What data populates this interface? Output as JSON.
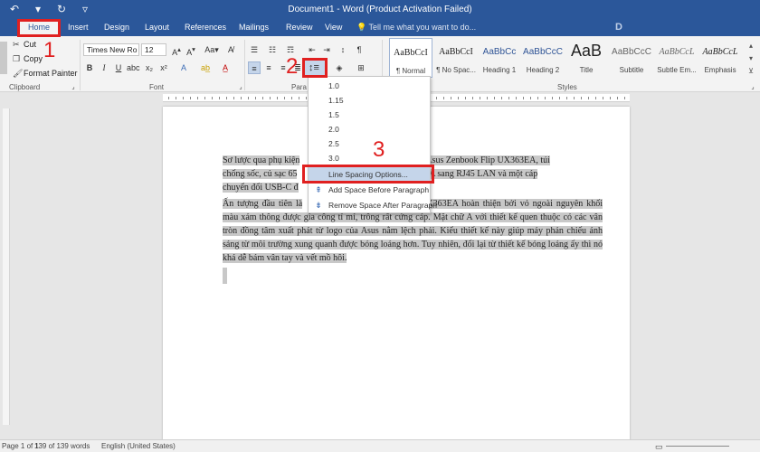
{
  "titlebar": {
    "title": "Document1 - Word (Product Activation Failed)"
  },
  "tabs": [
    {
      "label": "Home"
    },
    {
      "label": "Insert"
    },
    {
      "label": "Design"
    },
    {
      "label": "Layout"
    },
    {
      "label": "References"
    },
    {
      "label": "Mailings"
    },
    {
      "label": "Review"
    },
    {
      "label": "View"
    }
  ],
  "tell_me": "Tell me what you want to do...",
  "clipboard": {
    "cut": "Cut",
    "copy": "Copy",
    "format_painter": "Format Painter",
    "label": "Clipboard"
  },
  "font": {
    "name": "Times New Ro",
    "size": "12",
    "label": "Font"
  },
  "paragraph": {
    "label": "Para"
  },
  "styles": {
    "label": "Styles",
    "items": [
      {
        "preview": "AaBbCcI",
        "name": "¶ Normal"
      },
      {
        "preview": "AaBbCcI",
        "name": "¶ No Spac..."
      },
      {
        "preview": "AaBbCc",
        "name": "Heading 1"
      },
      {
        "preview": "AaBbCcC",
        "name": "Heading 2"
      },
      {
        "preview": "AaB",
        "name": "Title"
      },
      {
        "preview": "AaBbCcC",
        "name": "Subtitle"
      },
      {
        "preview": "AaBbCcL",
        "name": "Subtle Em..."
      },
      {
        "preview": "AaBbCcL",
        "name": "Emphasis"
      }
    ]
  },
  "line_spacing_menu": {
    "values": [
      "1.0",
      "1.15",
      "1.5",
      "2.0",
      "2.5",
      "3.0"
    ],
    "options": "Line Spacing Options...",
    "add_before": "Add Space Before Paragraph",
    "remove_after": "Remove Space After Paragraph"
  },
  "document": {
    "para1_a": "Sơ lược qua phụ kiện",
    "para1_b": "y Asus Zenbook Flip UX363EA, túi",
    "para1_c": "chống sốc, củ sạc 65",
    "para1_d": "yển USB-A sang RJ45 LAN và một cáp",
    "para1_e": "chuyển đổi USB-C đ",
    "para2_a": "Ấn tượng đầu tiên là",
    "para2_b": "UX363EA hoàn thiện bởi vỏ ngoài nguyên khối màu xám thông được gia công tỉ mỉ, trông rất cứng cáp. Mặt chữ A với thiết kế quen thuộc có các vân tròn đồng tâm xuất phát từ logo của Asus nằm lệch phải. Kiểu thiết kế này giúp máy phản chiếu ánh sáng từ môi trường xung quanh được bóng loáng hơn. Tuy nhiên, đổi lại từ thiết kế bóng loáng ấy thì nó khá dễ bám vân tay và vết mồ hôi."
  },
  "annotations": [
    "1",
    "2",
    "3"
  ],
  "statusbar": {
    "page": "Page 1 of 1",
    "words": "139 of 139 words",
    "language": "English (United States)"
  },
  "colors": {
    "accent": "#2b579a",
    "callout": "#e02020"
  }
}
